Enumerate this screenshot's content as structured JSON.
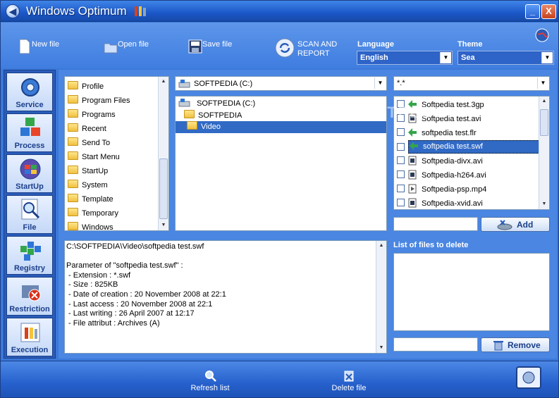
{
  "window": {
    "title": "Windows Optimum",
    "min_glyph": "_",
    "close_glyph": "X",
    "back_glyph": "◀"
  },
  "toolbar": {
    "new_file": "New file",
    "open_file": "Open file",
    "save_file": "Save file",
    "scan_and_report_line1": "SCAN AND",
    "scan_and_report_line2": "REPORT",
    "language_label": "Language",
    "language_value": "English",
    "theme_label": "Theme",
    "theme_value": "Sea"
  },
  "sidebar": {
    "items": [
      {
        "label": "Service"
      },
      {
        "label": "Process"
      },
      {
        "label": "StartUp"
      },
      {
        "label": "File"
      },
      {
        "label": "Registry"
      },
      {
        "label": "Restriction"
      },
      {
        "label": "Execution"
      }
    ]
  },
  "folder_tree": {
    "items": [
      "Profile",
      "Program Files",
      "Programs",
      "Recent",
      "Send To",
      "Start Menu",
      "StartUp",
      "System",
      "Template",
      "Temporary",
      "Windows"
    ]
  },
  "dir_combo": {
    "value": "SOFTPEDIA (C:)"
  },
  "dir_tree": {
    "items": [
      {
        "label": "SOFTPEDIA (C:)"
      },
      {
        "label": "SOFTPEDIA"
      },
      {
        "label": "Video"
      }
    ]
  },
  "filter_combo": {
    "value": "*.*"
  },
  "file_list": {
    "items": [
      {
        "label": "Softpedia test.3gp"
      },
      {
        "label": "Softpedia test.avi"
      },
      {
        "label": "softpedia test.flr"
      },
      {
        "label": "softpedia test.swf"
      },
      {
        "label": "Softpedia-divx.avi"
      },
      {
        "label": "Softpedia-h264.avi"
      },
      {
        "label": "Softpedia-psp.mp4"
      },
      {
        "label": "Softpedia-xvid.avi"
      }
    ]
  },
  "info_panel": {
    "path": "C:\\SOFTPEDIA\\Video\\softpedia test.swf",
    "heading": "Parameter of \"softpedia test.swf\" :",
    "extension": " - Extension : *.swf",
    "size": " - Size : 825KB",
    "date_creation": " - Date of creation : 20 November 2008 at 22:1",
    "last_access": " - Last access : 20 November 2008 at 22:1",
    "last_writing": " - Last writing : 26 April 2007 at 12:17",
    "file_attribut": " - File attribut : Archives (A)"
  },
  "add": {
    "label": "Add"
  },
  "delete_list": {
    "label": "List of files to delete"
  },
  "remove": {
    "label": "Remove"
  },
  "footer": {
    "refresh": "Refresh list",
    "delete": "Delete file"
  },
  "watermark": {
    "text": "SOFTPEDIA"
  },
  "colors": {
    "accent": "#316ac5",
    "panel_bg": "#4a86e2",
    "title_bg": "#1c57c8"
  }
}
